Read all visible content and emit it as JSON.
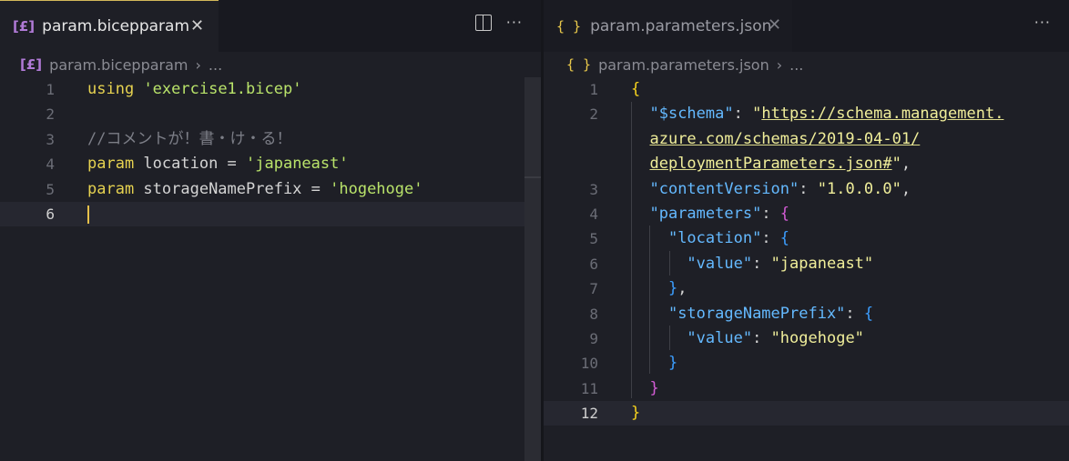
{
  "left": {
    "tab": {
      "label": "param.bicepparam",
      "close": "✕"
    },
    "actions": {
      "more": "···"
    },
    "breadcrumb": {
      "file": "param.bicepparam",
      "sep": "›",
      "rest": "..."
    },
    "lines": [
      {
        "n": "1",
        "tokens": [
          {
            "t": "using",
            "c": "kw"
          },
          {
            "t": " ",
            "c": ""
          },
          {
            "t": "'exercise1.bicep'",
            "c": "str"
          }
        ]
      },
      {
        "n": "2",
        "tokens": []
      },
      {
        "n": "3",
        "tokens": [
          {
            "t": "//コメントが！書・け・る！",
            "c": "cmt"
          }
        ]
      },
      {
        "n": "4",
        "tokens": [
          {
            "t": "param",
            "c": "kw"
          },
          {
            "t": " location = ",
            "c": ""
          },
          {
            "t": "'japaneast'",
            "c": "str"
          }
        ]
      },
      {
        "n": "5",
        "tokens": [
          {
            "t": "param",
            "c": "kw"
          },
          {
            "t": " storageNamePrefix = ",
            "c": ""
          },
          {
            "t": "'hogehoge'",
            "c": "str"
          }
        ]
      },
      {
        "n": "6",
        "tokens": []
      }
    ],
    "current_line": "6"
  },
  "right": {
    "tab": {
      "label": "param.parameters.json",
      "close": "✕"
    },
    "actions": {
      "more": "···"
    },
    "breadcrumb": {
      "icon": "{ }",
      "file": "param.parameters.json",
      "sep": "›",
      "rest": "..."
    },
    "lines": [
      {
        "n": "1",
        "tokens": [
          {
            "t": "{",
            "c": "brace-y"
          }
        ]
      },
      {
        "n": "2",
        "tokens": [
          {
            "t": "  ",
            "c": ""
          },
          {
            "t": "\"$schema\"",
            "c": "key"
          },
          {
            "t": ": ",
            "c": ""
          },
          {
            "t": "\"",
            "c": "jstr"
          },
          {
            "t": "https://schema.management.",
            "c": "jstr link"
          }
        ]
      },
      {
        "n": "",
        "tokens": [
          {
            "t": "  ",
            "c": ""
          },
          {
            "t": "azure.com/schemas/2019-04-01/",
            "c": "jstr link"
          }
        ]
      },
      {
        "n": "",
        "tokens": [
          {
            "t": "  ",
            "c": ""
          },
          {
            "t": "deploymentParameters.json#",
            "c": "jstr link"
          },
          {
            "t": "\"",
            "c": "jstr"
          },
          {
            "t": ",",
            "c": ""
          }
        ]
      },
      {
        "n": "3",
        "tokens": [
          {
            "t": "  ",
            "c": ""
          },
          {
            "t": "\"contentVersion\"",
            "c": "key"
          },
          {
            "t": ": ",
            "c": ""
          },
          {
            "t": "\"1.0.0.0\"",
            "c": "jstr"
          },
          {
            "t": ",",
            "c": ""
          }
        ]
      },
      {
        "n": "4",
        "tokens": [
          {
            "t": "  ",
            "c": ""
          },
          {
            "t": "\"parameters\"",
            "c": "key"
          },
          {
            "t": ": ",
            "c": ""
          },
          {
            "t": "{",
            "c": "brace-p"
          }
        ]
      },
      {
        "n": "5",
        "tokens": [
          {
            "t": "    ",
            "c": ""
          },
          {
            "t": "\"location\"",
            "c": "key"
          },
          {
            "t": ": ",
            "c": ""
          },
          {
            "t": "{",
            "c": "brace-b"
          }
        ]
      },
      {
        "n": "6",
        "tokens": [
          {
            "t": "      ",
            "c": ""
          },
          {
            "t": "\"value\"",
            "c": "key"
          },
          {
            "t": ": ",
            "c": ""
          },
          {
            "t": "\"japaneast\"",
            "c": "jstr"
          }
        ]
      },
      {
        "n": "7",
        "tokens": [
          {
            "t": "    ",
            "c": ""
          },
          {
            "t": "}",
            "c": "brace-b"
          },
          {
            "t": ",",
            "c": ""
          }
        ]
      },
      {
        "n": "8",
        "tokens": [
          {
            "t": "    ",
            "c": ""
          },
          {
            "t": "\"storageNamePrefix\"",
            "c": "key"
          },
          {
            "t": ": ",
            "c": ""
          },
          {
            "t": "{",
            "c": "brace-b"
          }
        ]
      },
      {
        "n": "9",
        "tokens": [
          {
            "t": "      ",
            "c": ""
          },
          {
            "t": "\"value\"",
            "c": "key"
          },
          {
            "t": ": ",
            "c": ""
          },
          {
            "t": "\"hogehoge\"",
            "c": "jstr"
          }
        ]
      },
      {
        "n": "10",
        "tokens": [
          {
            "t": "    ",
            "c": ""
          },
          {
            "t": "}",
            "c": "brace-b"
          }
        ]
      },
      {
        "n": "11",
        "tokens": [
          {
            "t": "  ",
            "c": ""
          },
          {
            "t": "}",
            "c": "brace-p"
          }
        ]
      },
      {
        "n": "12",
        "tokens": [
          {
            "t": "}",
            "c": "brace-y"
          }
        ]
      }
    ],
    "current_line": "12"
  },
  "icons": {
    "bicep": "bicep-file-icon",
    "json": "json-file-icon",
    "split": "split-editor-icon",
    "more": "more-actions-icon",
    "close": "close-icon"
  },
  "colors": {
    "keyword": "#e6d250",
    "string": "#b9e36a",
    "comment": "#7c7e87",
    "json_key": "#64b9ff",
    "json_string": "#f0ee9a",
    "cursor": "#e6c04a",
    "background": "#1e1f26"
  }
}
